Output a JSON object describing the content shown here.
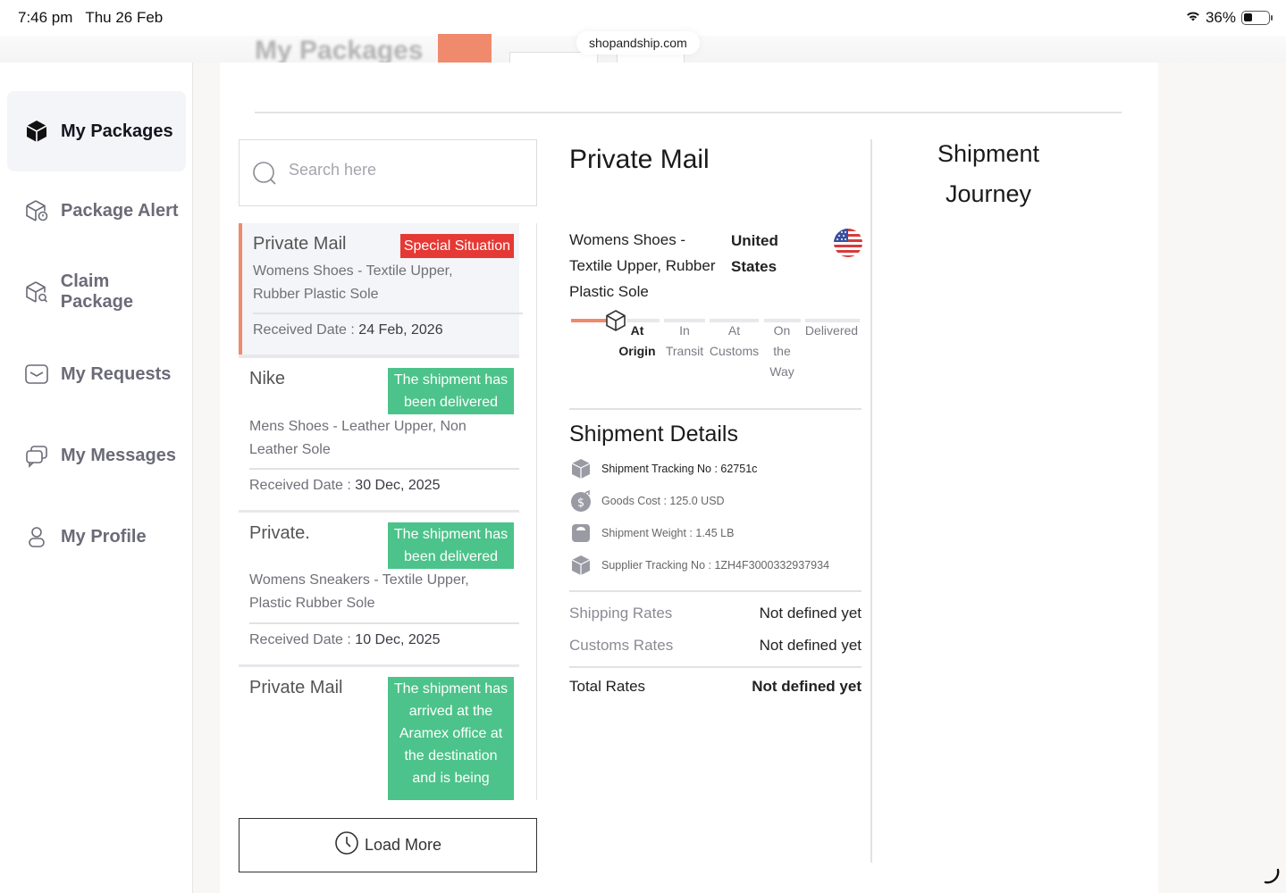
{
  "status_bar": {
    "time": "7:46 pm",
    "date": "Thu 26 Feb",
    "battery_percent": "36%",
    "battery_level": 0.36,
    "url": "shopandship.com"
  },
  "header": {
    "title": "My Packages"
  },
  "sidebar": {
    "items": [
      {
        "label": "My Packages",
        "icon": "package-icon",
        "active": true
      },
      {
        "label": "Package Alert",
        "icon": "package-alert-icon",
        "active": false
      },
      {
        "label": "Claim Package",
        "icon": "claim-package-icon",
        "active": false
      },
      {
        "label": "My Requests",
        "icon": "requests-icon",
        "active": false
      },
      {
        "label": "My Messages",
        "icon": "messages-icon",
        "active": false
      },
      {
        "label": "My Profile",
        "icon": "profile-icon",
        "active": false
      }
    ]
  },
  "search": {
    "placeholder": "Search here"
  },
  "packages": [
    {
      "title": "Private Mail",
      "status": "Special Situation",
      "status_color": "#e53935",
      "description": "Womens Shoes - Textile Upper, Rubber Plastic Sole",
      "date_label": "Received Date :",
      "date": "24 Feb, 2026"
    },
    {
      "title": "Nike",
      "status": "The shipment has been delivered",
      "status_color": "#4cc38a",
      "description": "Mens Shoes - Leather Upper, Non Leather Sole",
      "date_label": "Received Date :",
      "date": "30 Dec, 2025"
    },
    {
      "title": "Private.",
      "status": "The shipment has been delivered",
      "status_color": "#4cc38a",
      "description": "Womens Sneakers - Textile Upper, Plastic Rubber Sole",
      "date_label": "Received Date :",
      "date": "10 Dec, 2025"
    },
    {
      "title": "Private Mail",
      "status": "The shipment has arrived at the Aramex office at the destination and is being",
      "status_color": "#4cc38a"
    }
  ],
  "load_more_label": "Load More",
  "detail": {
    "title": "Private Mail",
    "description": "Womens Shoes - Textile Upper, Rubber Plastic Sole",
    "country": "United States",
    "progress_steps": [
      {
        "label": "At Origin",
        "active": true
      },
      {
        "label": "In Transit",
        "active": false
      },
      {
        "label": "At Customs",
        "active": false
      },
      {
        "label": "On the Way",
        "active": false
      },
      {
        "label": "Delivered",
        "active": false
      }
    ],
    "shipment_details_title": "Shipment Details",
    "shipment_details": [
      {
        "icon": "box-icon",
        "text": "Shipment Tracking No : 62751c"
      },
      {
        "icon": "dollar-icon",
        "text": "Goods Cost : 125.0 USD"
      },
      {
        "icon": "scale-icon",
        "text": "Shipment Weight : 1.45 LB"
      },
      {
        "icon": "box-icon",
        "text": "Supplier Tracking No : 1ZH4F3000332937934"
      }
    ],
    "rates": [
      {
        "label": "Shipping Rates",
        "value": "Not defined yet"
      },
      {
        "label": "Customs Rates",
        "value": "Not defined yet"
      }
    ],
    "total": {
      "label": "Total Rates",
      "value": "Not defined yet"
    }
  },
  "journey": {
    "title": "Shipment Journey"
  },
  "colors": {
    "accent": "#f08a6c",
    "danger": "#e53935",
    "success": "#4cc38a"
  }
}
